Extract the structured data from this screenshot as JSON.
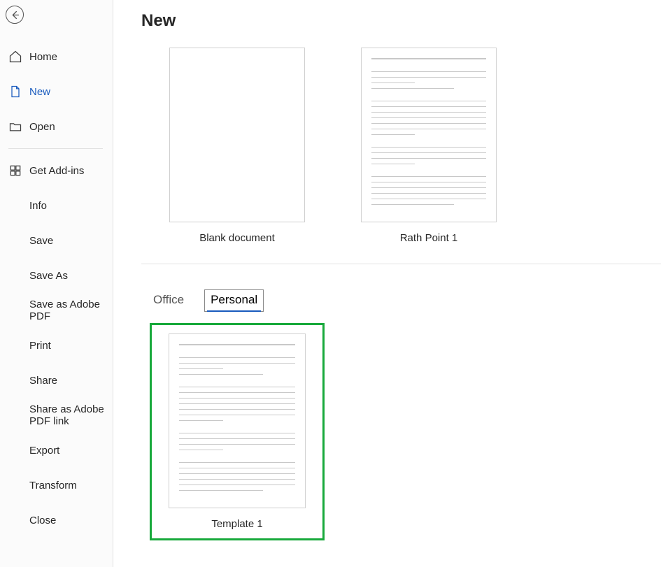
{
  "sidebar": {
    "items": [
      {
        "label": "Home",
        "icon": "home",
        "active": false
      },
      {
        "label": "New",
        "icon": "file",
        "active": true
      },
      {
        "label": "Open",
        "icon": "folder",
        "active": false
      }
    ],
    "items2": [
      {
        "label": "Get Add-ins",
        "icon": "grid"
      },
      {
        "label": "Info"
      },
      {
        "label": "Save"
      },
      {
        "label": "Save As"
      },
      {
        "label": "Save as Adobe PDF"
      },
      {
        "label": "Print"
      },
      {
        "label": "Share"
      },
      {
        "label": "Share as Adobe PDF link"
      },
      {
        "label": "Export"
      },
      {
        "label": "Transform"
      },
      {
        "label": "Close"
      }
    ]
  },
  "main": {
    "title": "New",
    "templates": [
      {
        "label": "Blank document",
        "kind": "blank"
      },
      {
        "label": "Rath Point 1",
        "kind": "doc"
      }
    ],
    "tabs": [
      {
        "label": "Office",
        "active": false
      },
      {
        "label": "Personal",
        "active": true
      }
    ],
    "personal_templates": [
      {
        "label": "Template 1",
        "kind": "doc",
        "selected": true
      }
    ]
  }
}
